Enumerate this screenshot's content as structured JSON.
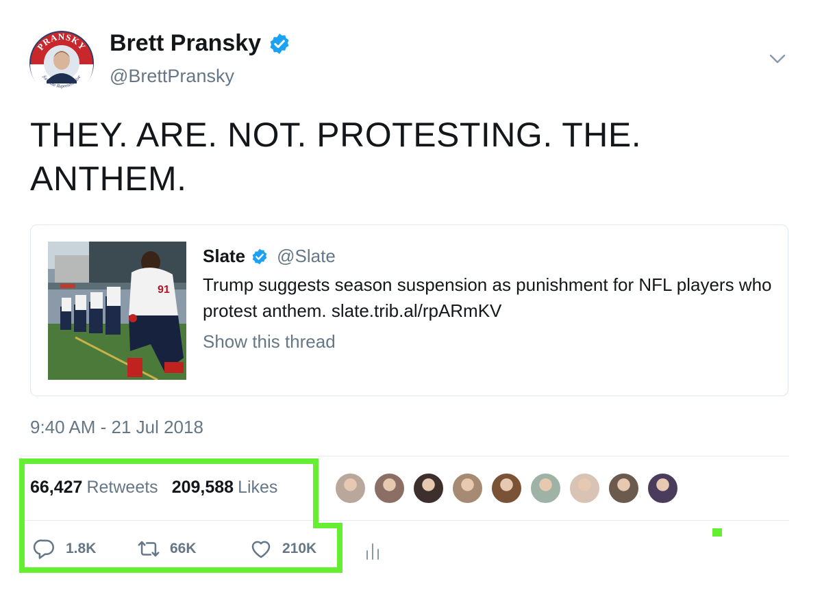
{
  "author": {
    "name": "Brett Pransky",
    "handle": "@BrettPransky",
    "avatar_text_top": "PRANSKY",
    "avatar_text_bottom": "for State Representative"
  },
  "tweet": {
    "text": "THEY. ARE. NOT. PROTESTING. THE. ANTHEM.",
    "timestamp": "9:40 AM - 21 Jul 2018"
  },
  "quote": {
    "name": "Slate",
    "handle": "@Slate",
    "text": "Trump suggests season suspension as punishment for NFL players who protest anthem. slate.trib.al/rpARmKV",
    "show_thread": "Show this thread"
  },
  "stats": {
    "retweets_count": "66,427",
    "retweets_label": "Retweets",
    "likes_count": "209,588",
    "likes_label": "Likes"
  },
  "actions": {
    "reply_count": "1.8K",
    "retweet_count": "66K",
    "like_count": "210K"
  },
  "colors": {
    "accent_blue": "#1da1f2",
    "secondary_text": "#657786",
    "highlight_green": "#66ee33",
    "avatar_red": "#c8282c",
    "avatar_navy": "#2a3f6e"
  },
  "icons": [
    "verified-badge-icon",
    "chevron-down-icon",
    "reply-icon",
    "retweet-icon",
    "heart-icon",
    "analytics-icon"
  ],
  "likers": [
    {
      "color": "#b9a79b"
    },
    {
      "color": "#8c6f64"
    },
    {
      "color": "#3d2f2c"
    },
    {
      "color": "#a78a74"
    },
    {
      "color": "#7a5236"
    },
    {
      "color": "#9fb2a6"
    },
    {
      "color": "#d8c3b4"
    },
    {
      "color": "#6b5a4e"
    },
    {
      "color": "#4a3d5c"
    }
  ]
}
